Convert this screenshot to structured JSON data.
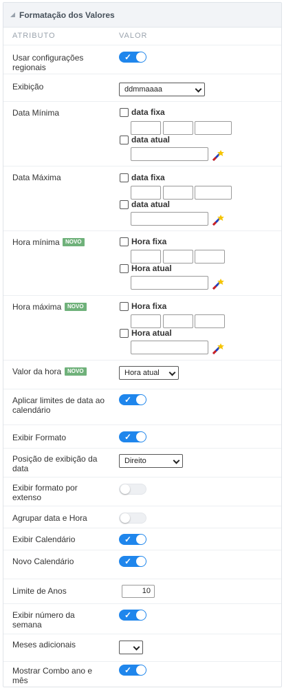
{
  "panel": {
    "title": "Formatação dos Valores"
  },
  "columns": {
    "attribute": "ATRIBUTO",
    "value": "VALOR"
  },
  "rows": {
    "regional": {
      "label": "Usar configurações regionais",
      "on": true
    },
    "display": {
      "label": "Exibição",
      "value": "ddmmaaaa"
    },
    "min_date": {
      "label": "Data Mínima",
      "fixed": "data fixa",
      "current": "data atual"
    },
    "max_date": {
      "label": "Data Máxima",
      "fixed": "data fixa",
      "current": "data atual"
    },
    "min_time": {
      "label": "Hora mínima",
      "badge": "NOVO",
      "fixed": "Hora fixa",
      "current": "Hora atual"
    },
    "max_time": {
      "label": "Hora máxima",
      "badge": "NOVO",
      "fixed": "Hora fixa",
      "current": "Hora atual"
    },
    "time_value": {
      "label": "Valor da hora",
      "badge": "NOVO",
      "value": "Hora atual"
    },
    "apply_limits": {
      "label": "Aplicar limites de data ao calendário",
      "on": true
    },
    "show_format": {
      "label": "Exibir Formato",
      "on": true
    },
    "position": {
      "label": "Posição de exibição da data",
      "value": "Direito"
    },
    "format_ext": {
      "label": "Exibir formato por extenso",
      "on": false
    },
    "group": {
      "label": "Agrupar data e Hora",
      "on": false
    },
    "calendar": {
      "label": "Exibir Calendário",
      "on": true
    },
    "new_calendar": {
      "label": "Novo Calendário",
      "on": true
    },
    "year_limit": {
      "label": "Limite de Anos",
      "value": "10"
    },
    "week_number": {
      "label": "Exibir número da semana",
      "on": true
    },
    "extra_months": {
      "label": "Meses adicionais",
      "value": ""
    },
    "combo": {
      "label": "Mostrar Combo ano e mês",
      "on": true
    }
  },
  "icons": {
    "toggle_check": "checkmark-icon",
    "wand": "magic-wand-icon"
  },
  "colors": {
    "accent": "#1f86ec",
    "badge": "#6fb17a",
    "header_bg": "#f2f4f7"
  }
}
